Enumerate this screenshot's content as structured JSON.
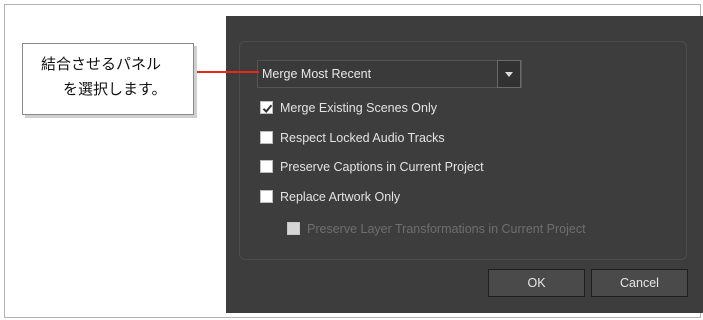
{
  "dialog": {
    "merge_select": {
      "value": "Merge Most Recent"
    },
    "options": [
      {
        "label": "Merge Existing Scenes Only",
        "checked": true,
        "enabled": true
      },
      {
        "label": "Respect Locked Audio Tracks",
        "checked": false,
        "enabled": true
      },
      {
        "label": "Preserve Captions in Current Project",
        "checked": false,
        "enabled": true
      },
      {
        "label": "Replace Artwork Only",
        "checked": false,
        "enabled": true
      },
      {
        "label": "Preserve Layer Transformations in Current Project",
        "checked": false,
        "enabled": false
      }
    ],
    "buttons": {
      "ok": "OK",
      "cancel": "Cancel"
    }
  },
  "callout": {
    "line1": "結合させるパネル",
    "line2": "を選択します。",
    "pointer_color": "#e8261b"
  },
  "colors": {
    "dialog_bg": "#3d3d3d",
    "text": "#e3e3e3",
    "disabled_text": "#6e6e6e"
  }
}
